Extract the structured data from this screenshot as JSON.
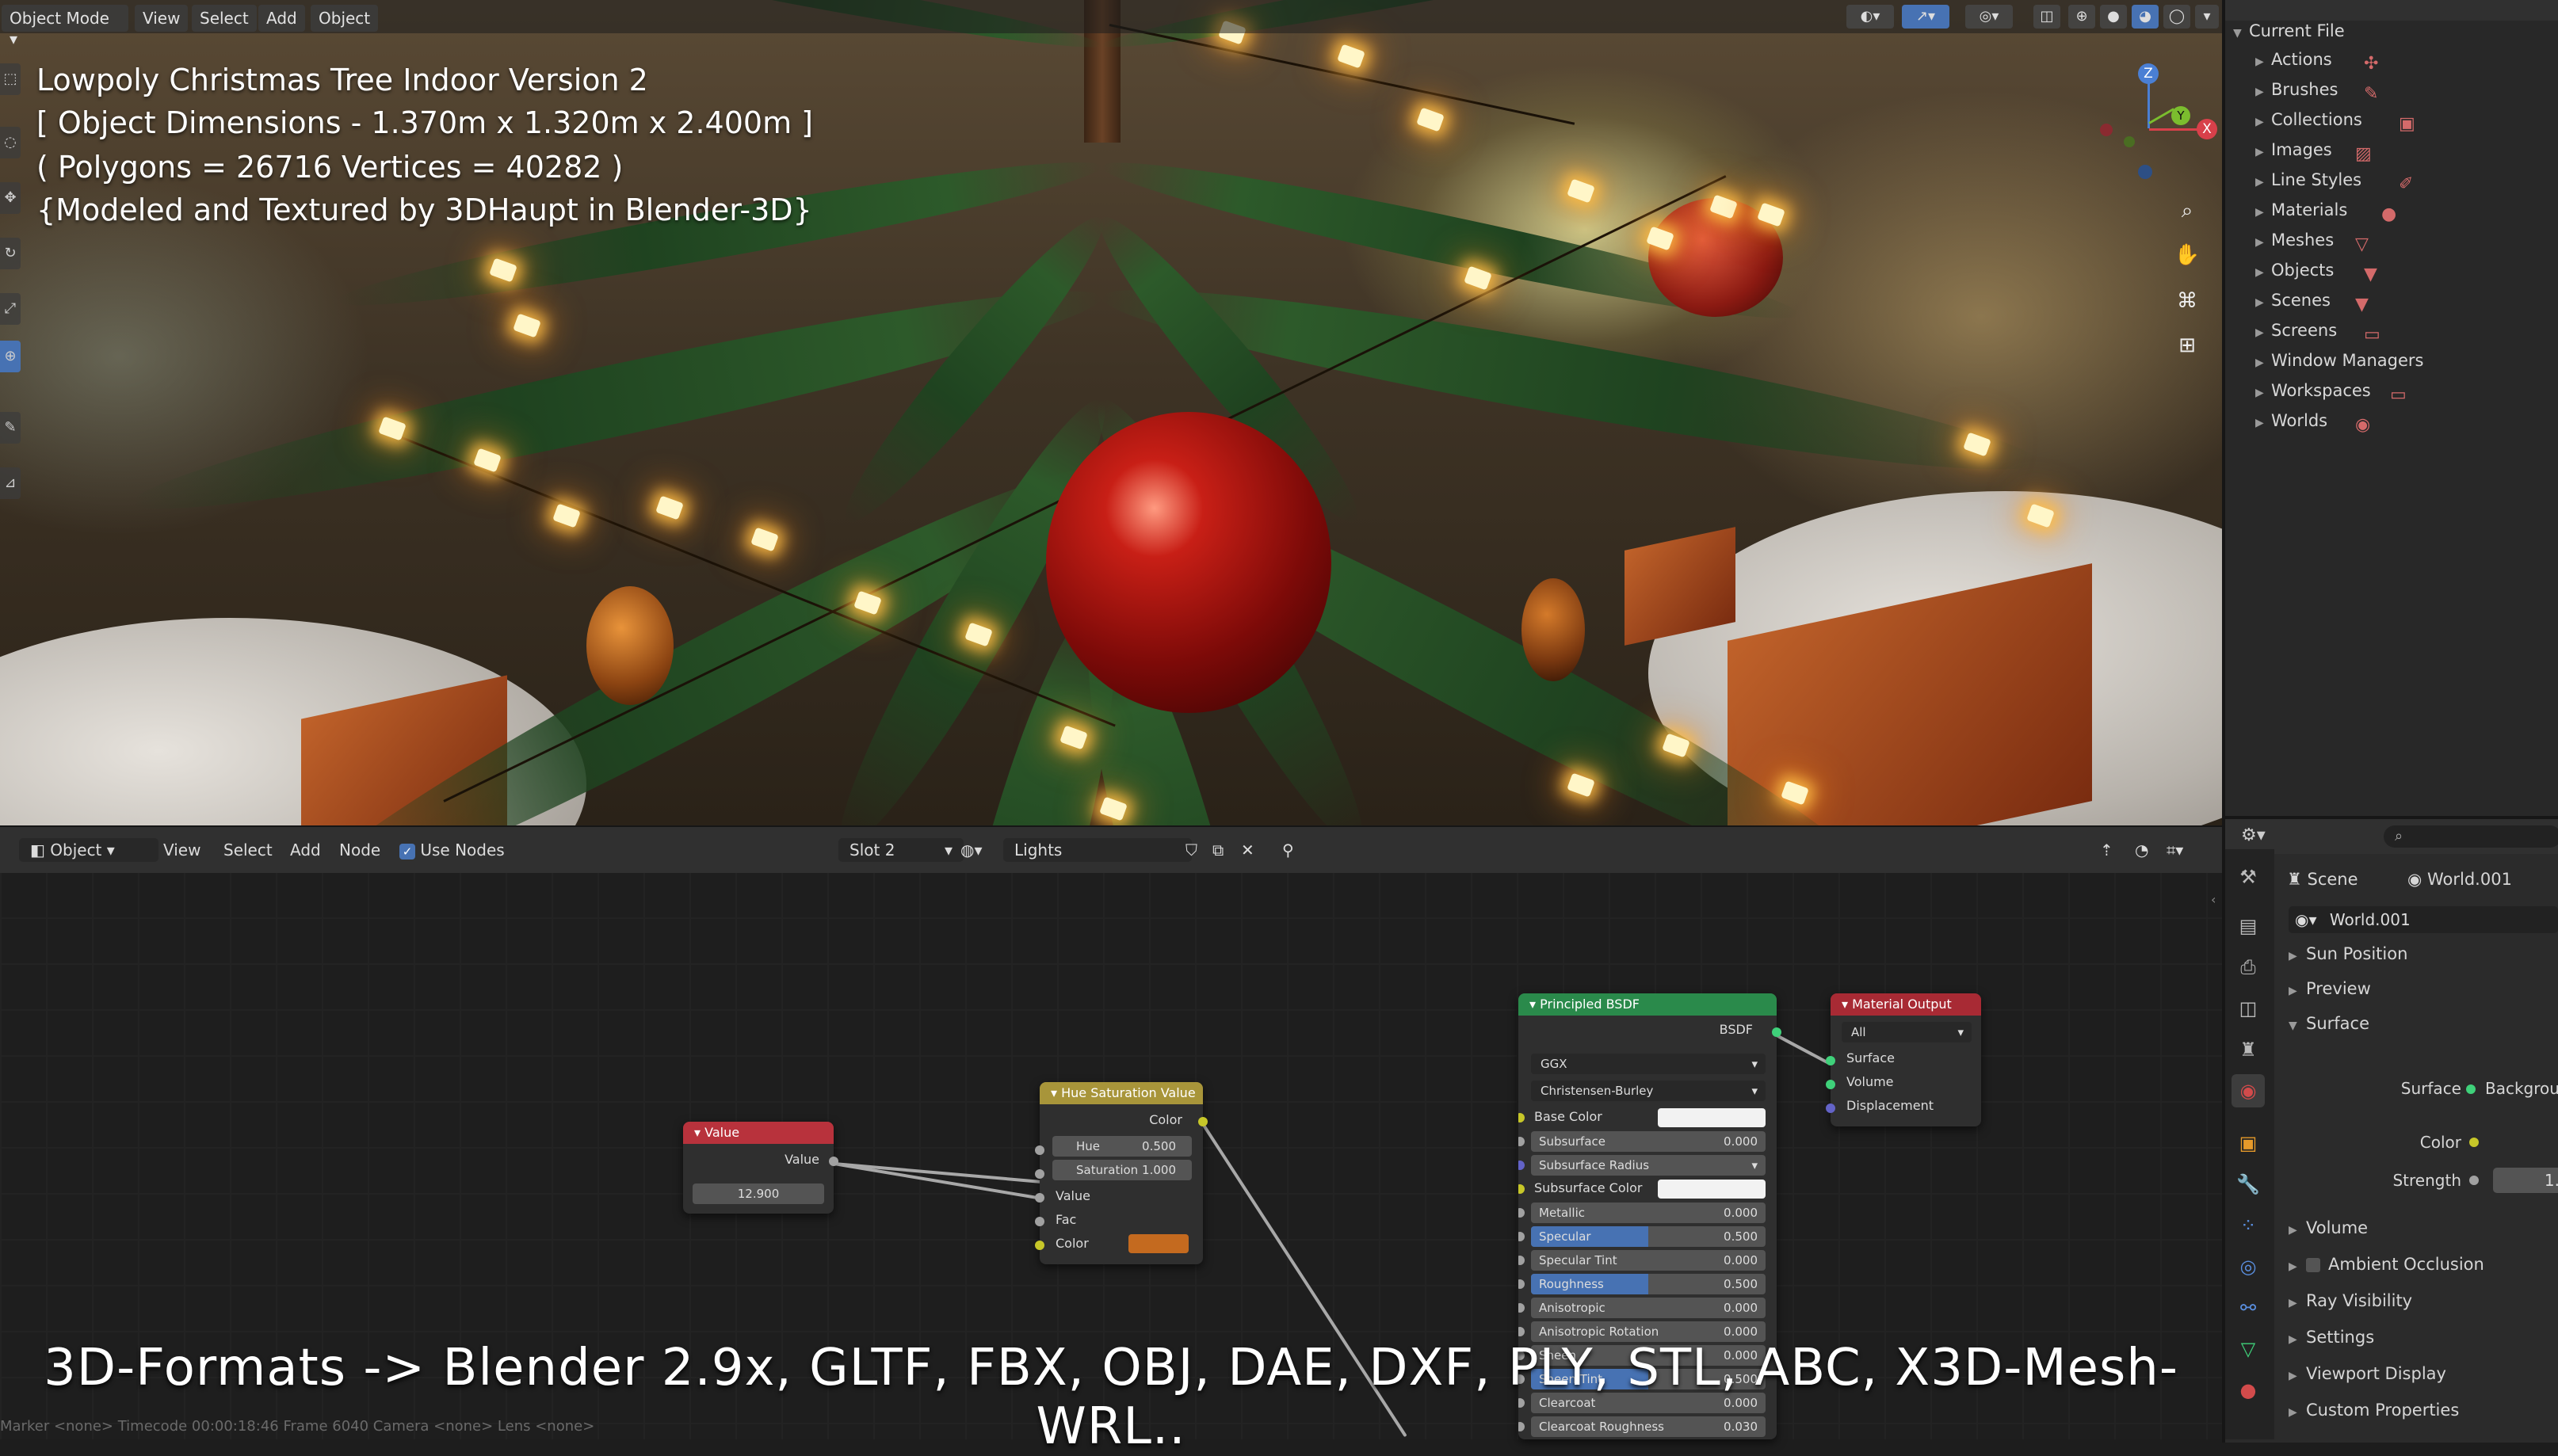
{
  "viewport": {
    "mode_menu": "Object Mode",
    "menus": [
      "View",
      "Select",
      "Add",
      "Object"
    ],
    "overlay_lines": [
      "Lowpoly Christmas Tree Indoor Version 2",
      "[ Object Dimensions -  1.370m x 1.320m x 2.400m ]",
      "( Polygons = 26716  Vertices = 40282 )",
      "{Modeled and Textured by 3DHaupt in Blender-3D}"
    ],
    "gizmo": {
      "z": "Z",
      "y": "Y",
      "x": "X"
    }
  },
  "outliner": {
    "root": "Current File",
    "items": [
      {
        "label": "Actions",
        "icon": "action-icon",
        "glyph": "✣"
      },
      {
        "label": "Brushes",
        "icon": "brush-icon",
        "glyph": "✎"
      },
      {
        "label": "Collections",
        "icon": "collection-icon",
        "glyph": "▣"
      },
      {
        "label": "Images",
        "icon": "image-icon",
        "glyph": "▨"
      },
      {
        "label": "Line Styles",
        "icon": "linestyle-icon",
        "glyph": "✐"
      },
      {
        "label": "Materials",
        "icon": "material-icon",
        "glyph": "●"
      },
      {
        "label": "Meshes",
        "icon": "mesh-icon",
        "glyph": "▽"
      },
      {
        "label": "Objects",
        "icon": "object-icon",
        "glyph": "▼"
      },
      {
        "label": "Scenes",
        "icon": "scene-icon",
        "glyph": "▼"
      },
      {
        "label": "Screens",
        "icon": "screen-icon",
        "glyph": "▭"
      },
      {
        "label": "Window Managers",
        "icon": "",
        "glyph": ""
      },
      {
        "label": "Workspaces",
        "icon": "workspace-icon",
        "glyph": "▭"
      },
      {
        "label": "Worlds",
        "icon": "world-icon",
        "glyph": "◉"
      }
    ]
  },
  "node_editor": {
    "editor_type": "Object",
    "menus": [
      "View",
      "Select",
      "Add",
      "Node"
    ],
    "use_nodes_label": "Use Nodes",
    "slot": "Slot 2",
    "material_name": "Lights",
    "nodes": {
      "value": {
        "title": "Value",
        "output": "Value",
        "field_value": "12.900"
      },
      "hsv": {
        "title": "Hue Saturation Value",
        "output": "Color",
        "hue_label": "Hue",
        "hue_value": "0.500",
        "sat_label": "Saturation",
        "sat_value": "1.000",
        "inputs": [
          "Value",
          "Fac",
          "Color"
        ],
        "color_swatch": "#c46a1f"
      },
      "bsdf": {
        "title": "Principled BSDF",
        "output": "BSDF",
        "distribution": "GGX",
        "subsurface_method": "Christensen-Burley",
        "rows": [
          {
            "label": "Base Color",
            "value": "",
            "kind": "color"
          },
          {
            "label": "Subsurface",
            "value": "0.000",
            "kind": "num"
          },
          {
            "label": "Subsurface Radius",
            "value": "",
            "kind": "menu"
          },
          {
            "label": "Subsurface Color",
            "value": "",
            "kind": "color"
          },
          {
            "label": "Metallic",
            "value": "0.000",
            "kind": "num"
          },
          {
            "label": "Specular",
            "value": "0.500",
            "kind": "bar"
          },
          {
            "label": "Specular Tint",
            "value": "0.000",
            "kind": "num"
          },
          {
            "label": "Roughness",
            "value": "0.500",
            "kind": "bar"
          },
          {
            "label": "Anisotropic",
            "value": "0.000",
            "kind": "num"
          },
          {
            "label": "Anisotropic Rotation",
            "value": "0.000",
            "kind": "num"
          },
          {
            "label": "Sheen",
            "value": "0.000",
            "kind": "num"
          },
          {
            "label": "Sheen Tint",
            "value": "0.500",
            "kind": "bar"
          },
          {
            "label": "Clearcoat",
            "value": "0.000",
            "kind": "num"
          },
          {
            "label": "Clearcoat Roughness",
            "value": "0.030",
            "kind": "num"
          }
        ]
      },
      "output": {
        "title": "Material Output",
        "target": "All",
        "inputs": [
          "Surface",
          "Volume",
          "Displacement"
        ]
      }
    }
  },
  "properties": {
    "scene_label": "Scene",
    "world_label": "World.001",
    "world_field": "World.001",
    "panels": [
      {
        "label": "Sun Position",
        "open": false
      },
      {
        "label": "Preview",
        "open": false
      },
      {
        "label": "Surface",
        "open": true
      }
    ],
    "surface_label": "Surface",
    "surface_value": "Background",
    "color_label": "Color",
    "strength_label": "Strength",
    "strength_value": "1.",
    "more_panels": [
      "Volume",
      "Ambient Occlusion",
      "Ray Visibility",
      "Settings",
      "Viewport Display",
      "Custom Properties"
    ]
  },
  "caption": "3D-Formats -> Blender 2.9x, GLTF, FBX, OBJ, DAE, DXF, PLY, STL, ABC, X3D-Mesh-WRL..",
  "statusbar": "Marker <none>   Timecode 00:00:18:46   Frame 6040   Camera <none>   Lens <none>",
  "colors": {
    "accent": "#4772b3",
    "value_node": "#c23a44",
    "hsv_node": "#b9a43a",
    "bsdf_node": "#2e9a55",
    "output_node": "#b2303a",
    "swatch_white": "#f2f2f2"
  }
}
